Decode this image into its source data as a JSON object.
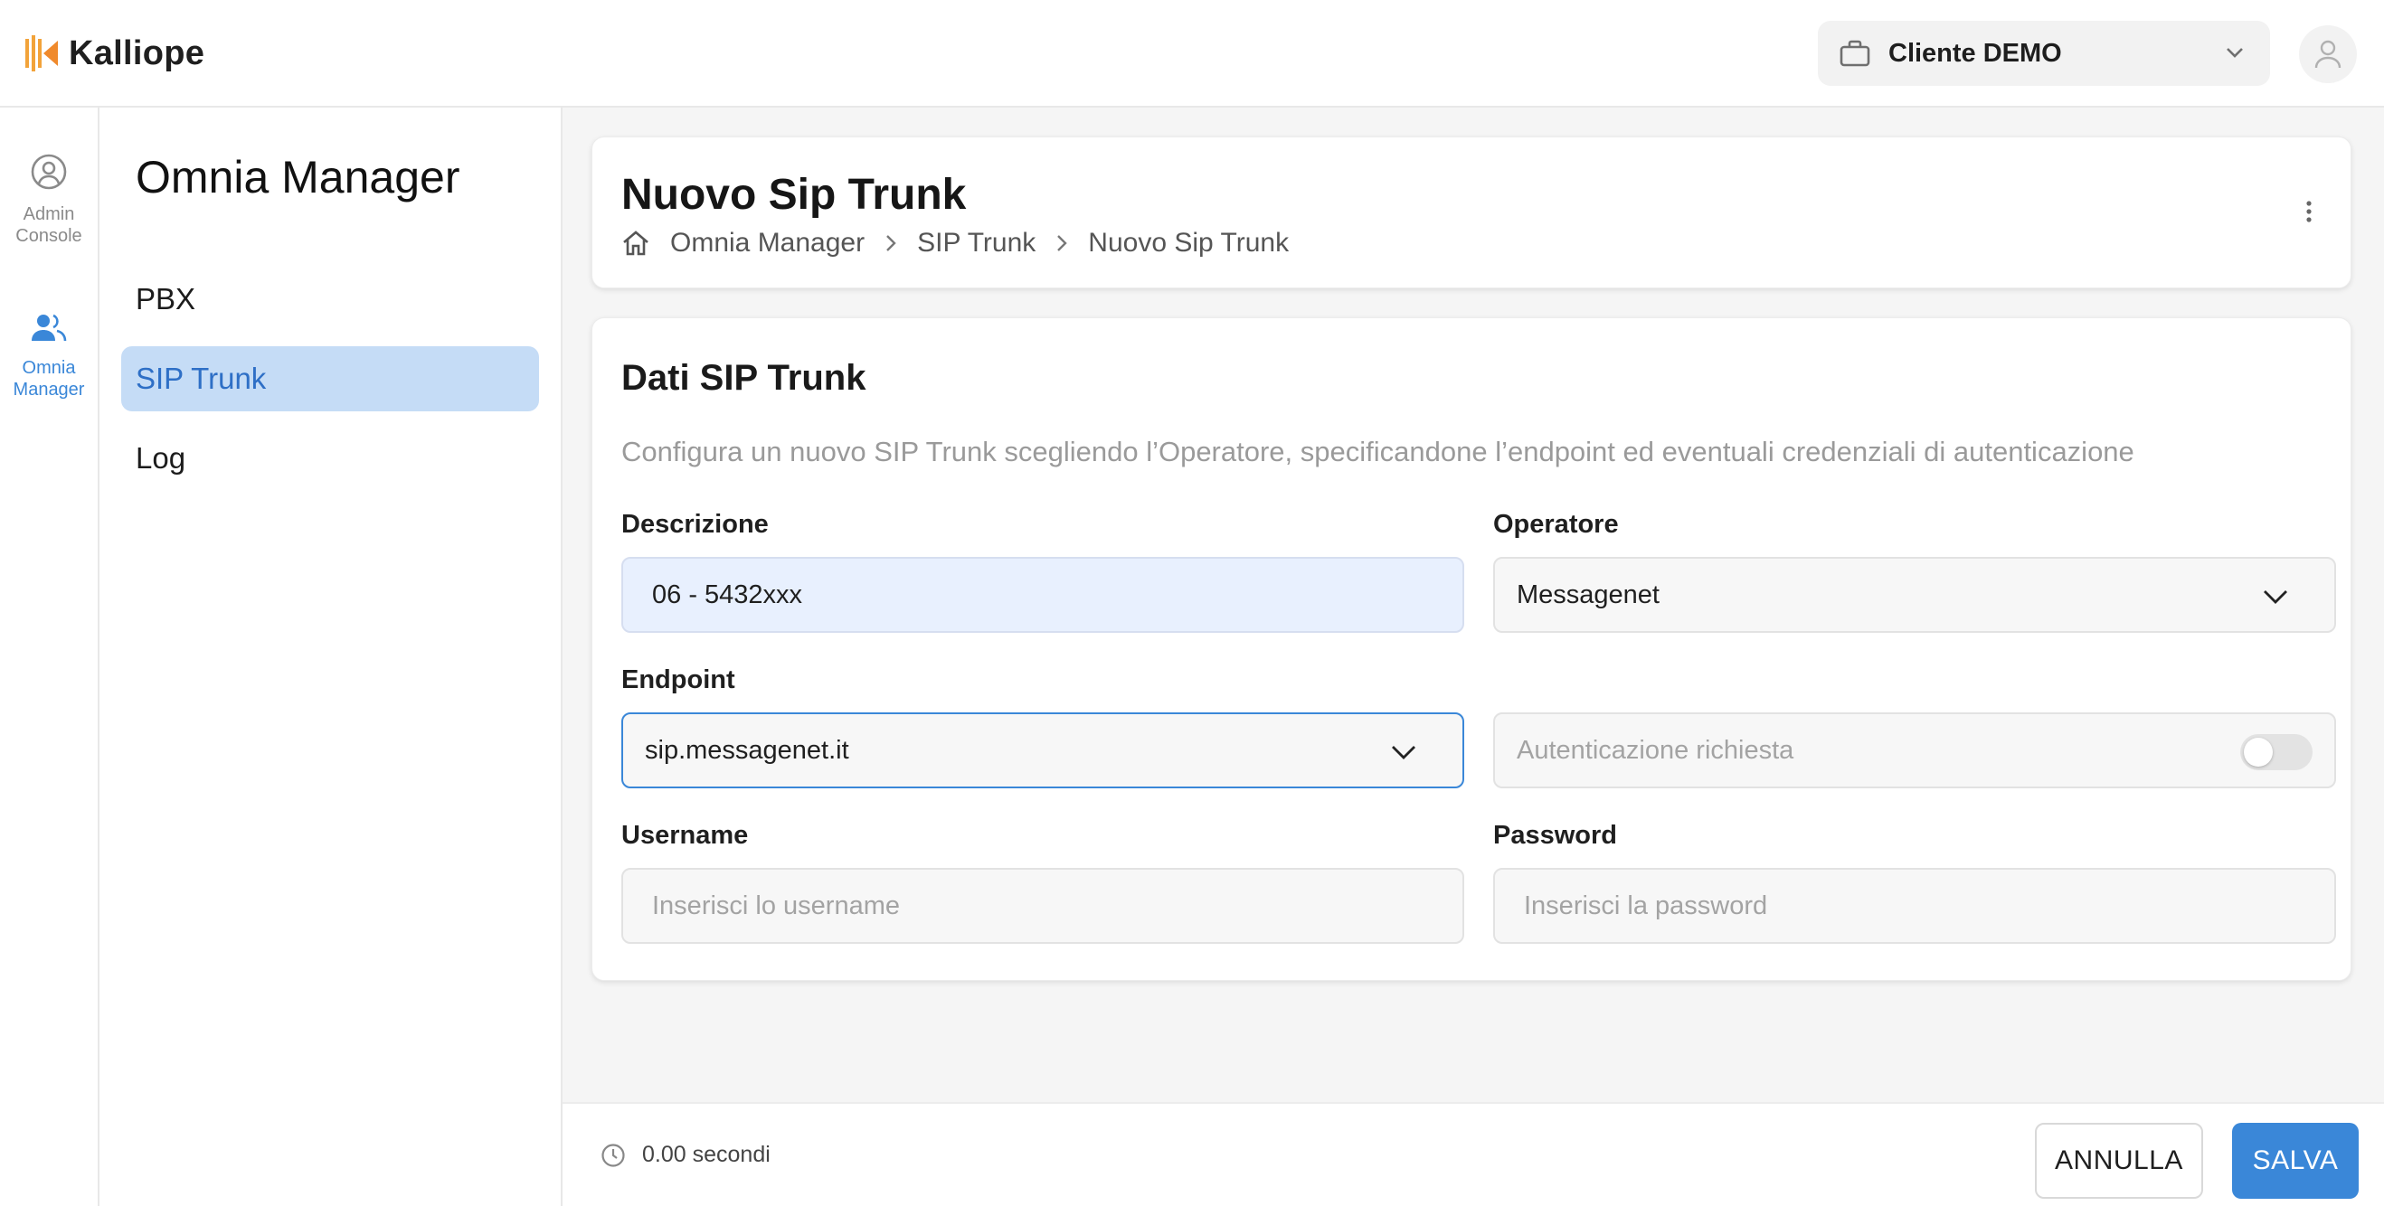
{
  "app": {
    "brand": "Kalliope",
    "accent": "#3a87d8",
    "active_nav_bg": "#c5dcf6"
  },
  "header": {
    "client_selector": "Cliente DEMO"
  },
  "rail": {
    "items": [
      {
        "label": "Admin Console",
        "icon": "user-circle-icon",
        "active": false
      },
      {
        "label": "Omnia Manager",
        "icon": "users-icon",
        "active": true
      }
    ]
  },
  "sidebar": {
    "title": "Omnia Manager",
    "items": [
      {
        "label": "PBX",
        "active": false
      },
      {
        "label": "SIP Trunk",
        "active": true
      },
      {
        "label": "Log",
        "active": false
      }
    ]
  },
  "page": {
    "title": "Nuovo Sip Trunk",
    "breadcrumb": [
      "Omnia Manager",
      "SIP Trunk",
      "Nuovo Sip Trunk"
    ]
  },
  "form": {
    "section_title": "Dati SIP Trunk",
    "description": "Configura un nuovo SIP Trunk scegliendo l’Operatore, specificandone l’endpoint ed eventuali credenziali di autenticazione",
    "descrizione": {
      "label": "Descrizione",
      "value": "06 - 5432xxx"
    },
    "operatore": {
      "label": "Operatore",
      "value": "Messagenet"
    },
    "endpoint": {
      "label": "Endpoint",
      "value": "sip.messagenet.it"
    },
    "autenticazione": {
      "label": "Autenticazione richiesta",
      "enabled": false
    },
    "username": {
      "label": "Username",
      "placeholder": "Inserisci lo username"
    },
    "password": {
      "label": "Password",
      "placeholder": "Inserisci la password"
    }
  },
  "footer": {
    "elapsed": "0.00 secondi",
    "cancel_label": "ANNULLA",
    "save_label": "SALVA"
  }
}
